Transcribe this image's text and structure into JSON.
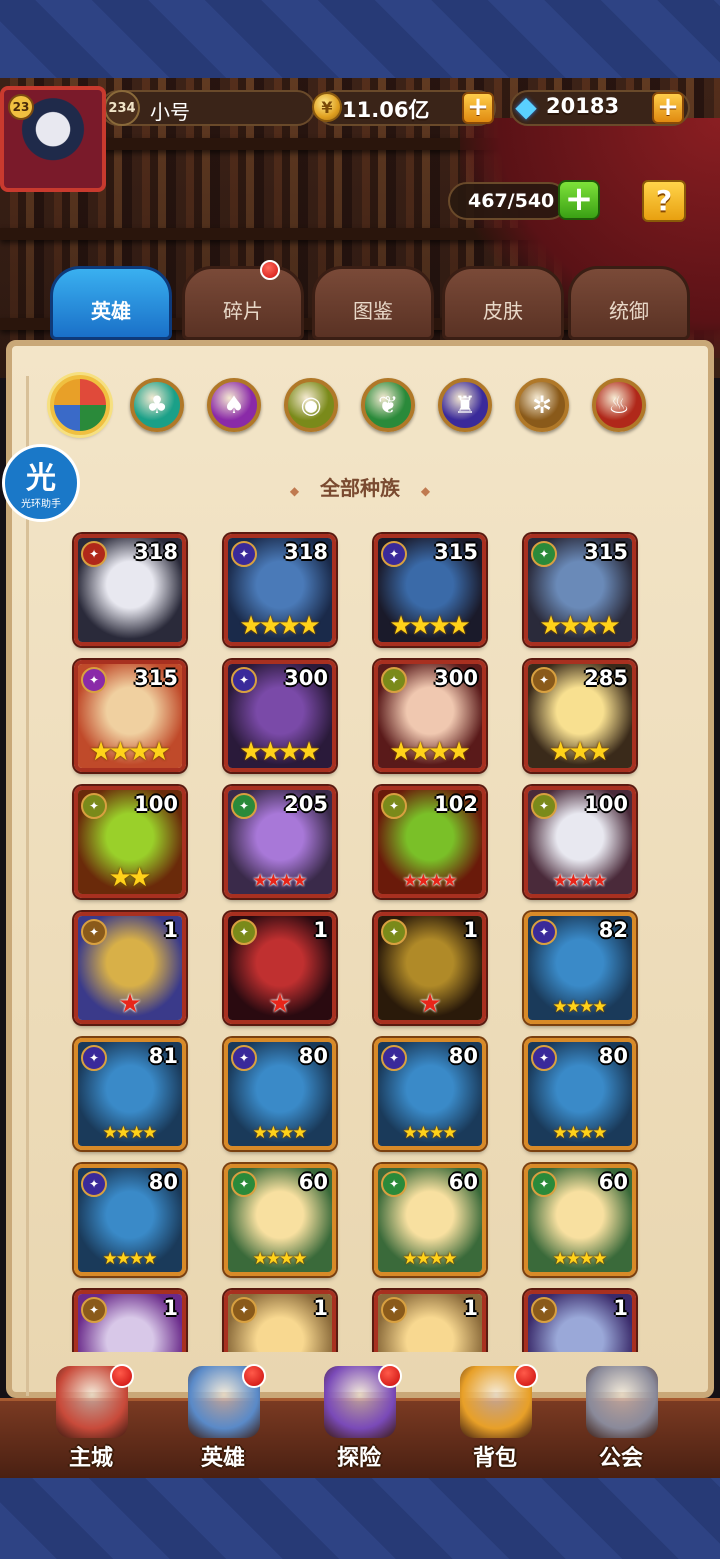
{
  "player": {
    "avatar_level": "23",
    "level": "234",
    "name": "小号",
    "gold": "11.06亿",
    "gems": "20183",
    "hero_capacity": "467/540",
    "gold_plus": "+",
    "gem_plus": "+",
    "capacity_plus": "+",
    "help": "?"
  },
  "tabs": [
    {
      "label": "英雄",
      "active": true,
      "has_dot": false
    },
    {
      "label": "碎片",
      "active": false,
      "has_dot": true
    },
    {
      "label": "图鉴",
      "active": false,
      "has_dot": false
    },
    {
      "label": "皮肤",
      "active": false,
      "has_dot": false
    },
    {
      "label": "统御",
      "active": false,
      "has_dot": false
    }
  ],
  "factions": [
    {
      "icon": "all-factions-icon",
      "color": "#e04a3a",
      "selected": true
    },
    {
      "icon": "forest-faction-icon",
      "color": "#1aa088"
    },
    {
      "icon": "abyss-faction-icon",
      "color": "#8a2aa8"
    },
    {
      "icon": "shadow-faction-icon",
      "color": "#7a8a1a"
    },
    {
      "icon": "fortress-faction-icon",
      "color": "#2a8a3a"
    },
    {
      "icon": "dark-faction-icon",
      "color": "#3a2a9a"
    },
    {
      "icon": "light-faction-icon",
      "color": "#8a5a1a"
    },
    {
      "icon": "transcendence-faction-icon",
      "color": "#b0281a"
    }
  ],
  "filter_label": "全部种族",
  "helper_badge": {
    "glyph": "光",
    "text": "光环助手"
  },
  "heroes": [
    {
      "level": "318",
      "stars": 0,
      "star_type": "none",
      "faction": "#b0281a",
      "frame": "red",
      "portrait": [
        "#e8e8f0",
        "#2a2a3a"
      ]
    },
    {
      "level": "318",
      "stars": 4,
      "star_type": "gold",
      "faction": "#3a2a9a",
      "frame": "red",
      "portrait": [
        "#4a7ab8",
        "#1a2a4a"
      ]
    },
    {
      "level": "315",
      "stars": 4,
      "star_type": "gold",
      "faction": "#3a2a9a",
      "frame": "red",
      "portrait": [
        "#3a6aa8",
        "#1a1a2a"
      ]
    },
    {
      "level": "315",
      "stars": 4,
      "star_type": "gold",
      "faction": "#2a8a3a",
      "frame": "red",
      "portrait": [
        "#6a8ab8",
        "#2a2a3a"
      ]
    },
    {
      "level": "315",
      "stars": 4,
      "star_type": "gold",
      "faction": "#8a2aa8",
      "frame": "red",
      "portrait": [
        "#f0d0a0",
        "#c04a2a"
      ]
    },
    {
      "level": "300",
      "stars": 4,
      "star_type": "gold",
      "faction": "#3a2a9a",
      "frame": "red",
      "portrait": [
        "#7a4aa8",
        "#2a1a3a"
      ]
    },
    {
      "level": "300",
      "stars": 4,
      "star_type": "gold",
      "faction": "#7a8a1a",
      "frame": "red",
      "portrait": [
        "#f0c8b0",
        "#5a1a1a"
      ]
    },
    {
      "level": "285",
      "stars": 3,
      "star_type": "gold",
      "faction": "#8a5a1a",
      "frame": "red",
      "portrait": [
        "#f8e090",
        "#3a2a1a"
      ]
    },
    {
      "level": "100",
      "stars": 2,
      "star_type": "gold",
      "faction": "#7a8a1a",
      "frame": "red",
      "portrait": [
        "#9ad02a",
        "#6a2a0a"
      ]
    },
    {
      "level": "205",
      "stars": 4,
      "star_type": "red-small",
      "faction": "#2a8a3a",
      "frame": "red",
      "portrait": [
        "#a878d8",
        "#3a2a4a"
      ]
    },
    {
      "level": "102",
      "stars": 4,
      "star_type": "red-small",
      "faction": "#7a8a1a",
      "frame": "red",
      "portrait": [
        "#7ac028",
        "#6a1a0a"
      ]
    },
    {
      "level": "100",
      "stars": 4,
      "star_type": "red-small",
      "faction": "#7a8a1a",
      "frame": "red",
      "portrait": [
        "#e8e8f0",
        "#4a2a3a"
      ]
    },
    {
      "level": "1",
      "stars": 1,
      "star_type": "red",
      "faction": "#8a5a1a",
      "frame": "red",
      "portrait": [
        "#d8b048",
        "#3a3a8a"
      ]
    },
    {
      "level": "1",
      "stars": 1,
      "star_type": "red",
      "faction": "#7a8a1a",
      "frame": "red",
      "portrait": [
        "#c03030",
        "#2a0a10"
      ]
    },
    {
      "level": "1",
      "stars": 1,
      "star_type": "red",
      "faction": "#7a8a1a",
      "frame": "red",
      "portrait": [
        "#b08a28",
        "#2a1a0a"
      ]
    },
    {
      "level": "82",
      "stars": 4,
      "star_type": "gold-small",
      "faction": "#3a2a9a",
      "frame": "gold",
      "portrait": [
        "#3a8ac8",
        "#1a3a5a"
      ]
    },
    {
      "level": "81",
      "stars": 4,
      "star_type": "gold-small",
      "faction": "#3a2a9a",
      "frame": "gold",
      "portrait": [
        "#3a8ac8",
        "#1a3a5a"
      ]
    },
    {
      "level": "80",
      "stars": 4,
      "star_type": "gold-small",
      "faction": "#3a2a9a",
      "frame": "gold",
      "portrait": [
        "#3a8ac8",
        "#1a3a5a"
      ]
    },
    {
      "level": "80",
      "stars": 4,
      "star_type": "gold-small",
      "faction": "#3a2a9a",
      "frame": "gold",
      "portrait": [
        "#3a8ac8",
        "#1a3a5a"
      ]
    },
    {
      "level": "80",
      "stars": 4,
      "star_type": "gold-small",
      "faction": "#3a2a9a",
      "frame": "gold",
      "portrait": [
        "#3a8ac8",
        "#1a3a5a"
      ]
    },
    {
      "level": "80",
      "stars": 4,
      "star_type": "gold-small",
      "faction": "#3a2a9a",
      "frame": "gold",
      "portrait": [
        "#3a8ac8",
        "#1a3a5a"
      ]
    },
    {
      "level": "60",
      "stars": 4,
      "star_type": "gold-small",
      "faction": "#2a8a3a",
      "frame": "gold",
      "portrait": [
        "#f8e0a0",
        "#3a6a3a"
      ]
    },
    {
      "level": "60",
      "stars": 4,
      "star_type": "gold-small",
      "faction": "#2a8a3a",
      "frame": "gold",
      "portrait": [
        "#f8e0a0",
        "#3a6a3a"
      ]
    },
    {
      "level": "60",
      "stars": 4,
      "star_type": "gold-small",
      "faction": "#2a8a3a",
      "frame": "gold",
      "portrait": [
        "#f8e0a0",
        "#3a6a3a"
      ]
    },
    {
      "level": "1",
      "stars": 0,
      "star_type": "none",
      "faction": "#8a5a1a",
      "frame": "red",
      "portrait": [
        "#d8c8e8",
        "#6a2a8a"
      ]
    },
    {
      "level": "1",
      "stars": 0,
      "star_type": "none",
      "faction": "#8a5a1a",
      "frame": "red",
      "portrait": [
        "#f8d890",
        "#8a6a3a"
      ]
    },
    {
      "level": "1",
      "stars": 0,
      "star_type": "none",
      "faction": "#8a5a1a",
      "frame": "red",
      "portrait": [
        "#f8d890",
        "#8a6a3a"
      ]
    },
    {
      "level": "1",
      "stars": 0,
      "star_type": "none",
      "faction": "#8a5a1a",
      "frame": "red",
      "portrait": [
        "#9aa8d8",
        "#3a2a6a"
      ]
    }
  ],
  "bottom_nav": [
    {
      "label": "主城",
      "icon": "castle-icon",
      "has_dot": true,
      "color": "#c84a3a"
    },
    {
      "label": "英雄",
      "icon": "hero-icon",
      "has_dot": true,
      "color": "#5a8ac8"
    },
    {
      "label": "探险",
      "icon": "portal-icon",
      "has_dot": true,
      "color": "#7a4ab8"
    },
    {
      "label": "背包",
      "icon": "backpack-icon",
      "has_dot": true,
      "color": "#e8a028"
    },
    {
      "label": "公会",
      "icon": "guild-icon",
      "has_dot": false,
      "color": "#8a8a9a"
    }
  ]
}
